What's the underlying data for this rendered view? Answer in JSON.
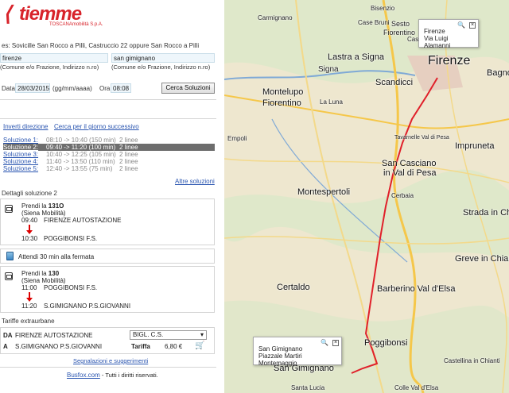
{
  "logo": {
    "brand": "tiemme",
    "sub": "TOSCANAmobilità S.p.A."
  },
  "example": "es: Sovicille San Rocco a Pilli, Castruccio 22 oppure San Rocco a Pilli",
  "origin": {
    "value": "firenze",
    "hint": "(Comune e/o Frazione, Indirizzo n.ro)"
  },
  "destination": {
    "value": "san gimignano",
    "hint": "(Comune e/o Frazione, Indirizzo n.ro)"
  },
  "date": {
    "label": "Data",
    "value": "28/03/2015",
    "format": "(gg/mm/aaaa)"
  },
  "time": {
    "label": "Ora",
    "value": "08:08"
  },
  "search_button": "Cerca Soluzioni",
  "links": {
    "invert": "Inverti direzione",
    "next_day": "Cerca per il giorno successivo",
    "more": "Altre soluzioni"
  },
  "solutions": [
    {
      "label": "Soluzione 1:",
      "time": "08:10 -> 10:40 (150 min)",
      "lines": "2 linee"
    },
    {
      "label": "Soluzione 2:",
      "time": "09:40 -> 11:20 (100 min)",
      "lines": "2 linee"
    },
    {
      "label": "Soluzione 3:",
      "time": "10:40 -> 12:25 (105 min)",
      "lines": "2 linee"
    },
    {
      "label": "Soluzione 4:",
      "time": "11:40 -> 13:50 (110 min)",
      "lines": "2 linee"
    },
    {
      "label": "Soluzione 5:",
      "time": "12:40 -> 13:55 (75 min)",
      "lines": "2 linee"
    }
  ],
  "details": {
    "title": "Dettagli soluzione 2",
    "leg1": {
      "take": "Prendi la ",
      "line": "131O",
      "op": "(Siena Mobilità)",
      "dep_time": "09:40",
      "dep_stop": "FIRENZE AUTOSTAZIONE",
      "arr_time": "10:30",
      "arr_stop": "POGGIBONSI F.S."
    },
    "wait": "Attendi 30 min alla fermata",
    "leg2": {
      "take": "Prendi la ",
      "line": "130",
      "op": "(Siena Mobilità)",
      "dep_time": "11:00",
      "dep_stop": "POGGIBONSI F.S.",
      "arr_time": "11:20",
      "arr_stop": "S.GIMIGNANO P.S.GIOVANNI"
    }
  },
  "tariffs": {
    "title": "Tariffe extraurbane",
    "from_label": "DA",
    "from_stop": "FIRENZE AUTOSTAZIONE",
    "ticket": "BIGL. C.S.",
    "to_label": "A",
    "to_stop": "S.GIMIGNANO P.S.GIOVANNI",
    "tariff_label": "Tariffa",
    "tariff_value": "6,80 €"
  },
  "footer": {
    "report": "Segnalazioni e suggerimenti",
    "brand": "Busfox.com",
    "rights": " - Tutti i diritti riservati."
  },
  "map": {
    "popup_top": {
      "line1": "Firenze",
      "line2": "Via Luigi Alamanni"
    },
    "popup_bottom": {
      "line1": "San Gimignano",
      "line2": "Piazzale Martiri Montemaggio"
    },
    "towns": [
      "Carmignano",
      "Bisenzio",
      "Sesto",
      "Fiorentino",
      "Castello",
      "Case Bruni",
      "Lastra a Signa",
      "Signa",
      "Firenze",
      "Bagno a Ripoli",
      "Montelupo",
      "Fiorentino",
      "La Luna",
      "Scandicci",
      "San Casciano",
      "in Val di Pesa",
      "Impruneta",
      "Empoli",
      "Montespertoli",
      "Cerbaia",
      "Strada in Chianti",
      "Certaldo",
      "Barberino Val d'Elsa",
      "Greve in Chianti",
      "Poggibonsi",
      "San Gimignano",
      "Castellina in Chianti",
      "Santa Lucia",
      "Colle Val d'Elsa",
      "Tavarnelle Val di Pesa"
    ]
  },
  "colors": {
    "brand_red": "#d8232a",
    "link": "#2a55b0",
    "selected": "#6d6d6d",
    "route": "#e0202a"
  }
}
